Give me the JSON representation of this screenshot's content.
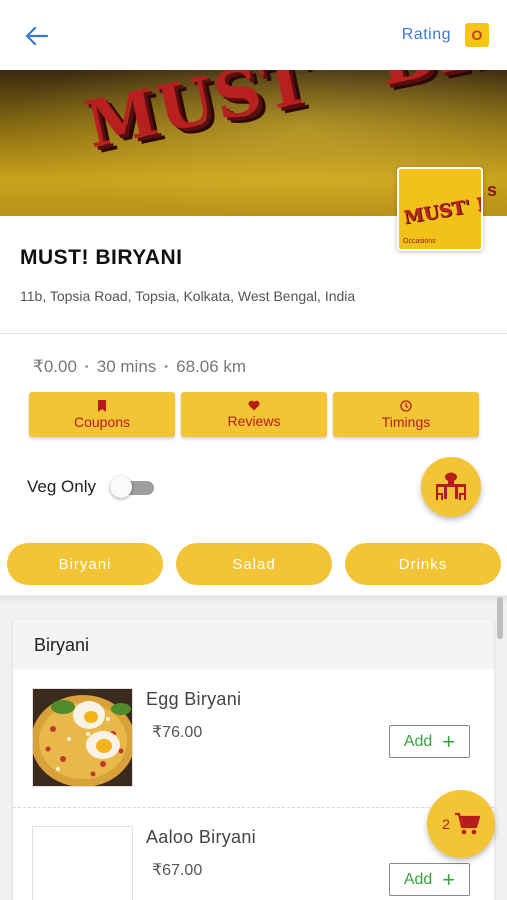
{
  "header": {
    "rating_label": "Rating",
    "rating_value": "O"
  },
  "banner": {
    "sign_text": "MUST ' BIRYANI",
    "sign_subtext": "Chase   s",
    "logo_text": "MUST' BIRY",
    "logo_subtext": "Occasions"
  },
  "restaurant": {
    "name": "MUST! BIRYANI",
    "address": "11b, Topsia Road, Topsia, Kolkata, West Bengal, India"
  },
  "stats": {
    "cost": "₹0.00",
    "time": "30 mins",
    "distance": "68.06 km",
    "separator": "•"
  },
  "actions": [
    {
      "label": "Coupons",
      "icon": "bookmark-icon"
    },
    {
      "label": "Reviews",
      "icon": "heart-icon"
    },
    {
      "label": "Timings",
      "icon": "clock-icon"
    }
  ],
  "veg_filter": {
    "label": "Veg Only",
    "enabled": false
  },
  "categories": [
    "Biryani",
    "Salad",
    "Drinks"
  ],
  "menu": {
    "section_title": "Biryani",
    "add_label": "Add",
    "add_icon": "+",
    "items": [
      {
        "name": "Egg Biryani",
        "price": "₹76.00"
      },
      {
        "name": "Aaloo Biryani",
        "price": "₹67.00"
      }
    ]
  },
  "cart": {
    "count": "2"
  },
  "colors": {
    "accent": "#f3c536",
    "accent_text": "#b71c1c",
    "link_blue": "#3a78d6",
    "add_green": "#3aa142"
  }
}
